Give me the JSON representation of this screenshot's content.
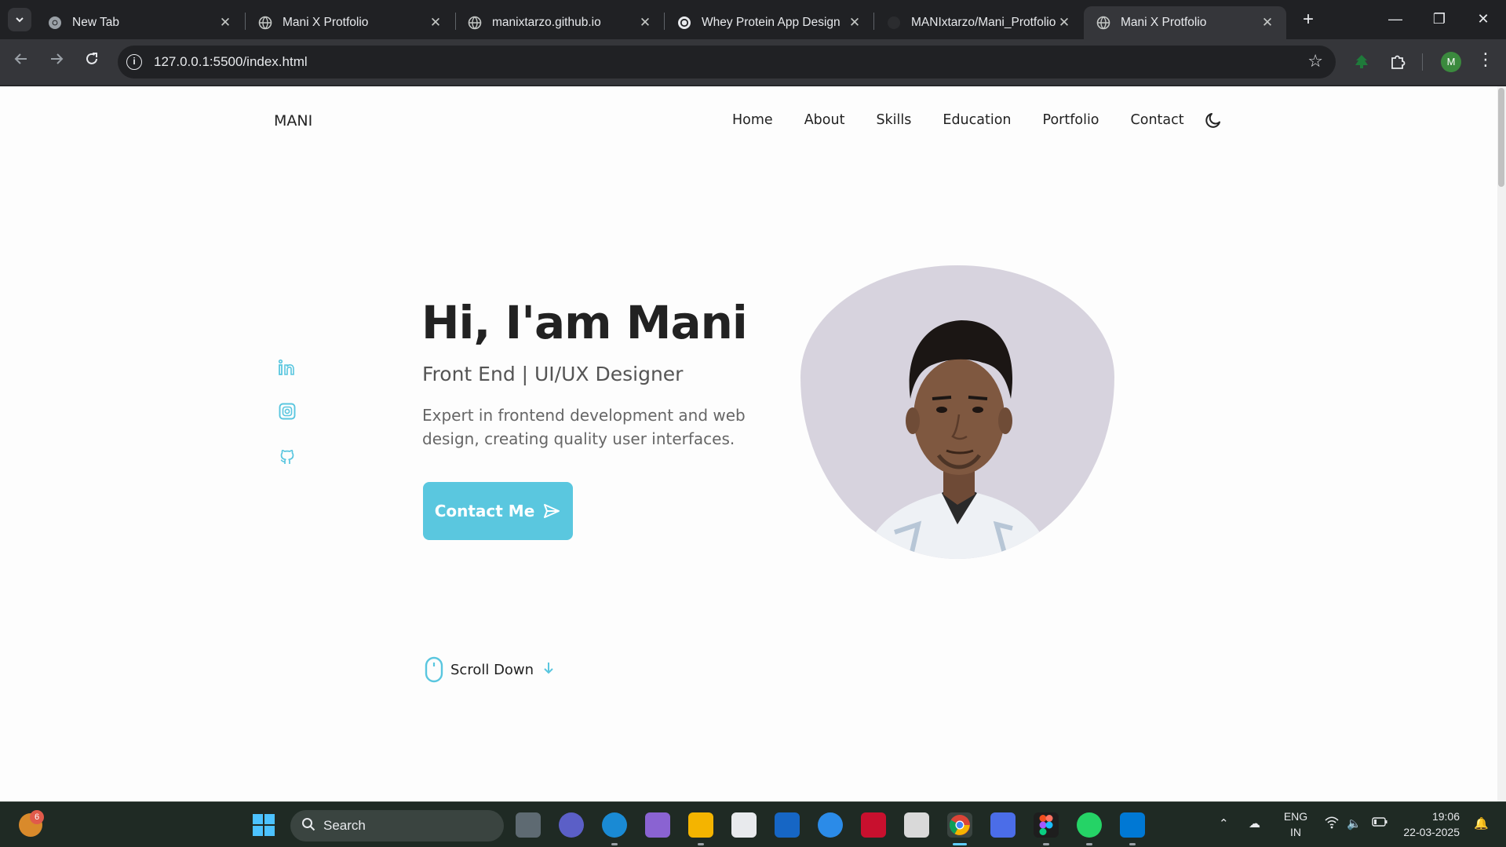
{
  "browser": {
    "tabs": [
      {
        "title": "New Tab",
        "active": false
      },
      {
        "title": "Mani X Protfolio",
        "active": false
      },
      {
        "title": "manixtarzo.github.io",
        "active": false
      },
      {
        "title": "Whey Protein App Design",
        "active": false
      },
      {
        "title": "MANIxtarzo/Mani_Protfolio",
        "active": false
      },
      {
        "title": "Mani X Protfolio",
        "active": true
      }
    ],
    "url": "127.0.0.1:5500/index.html",
    "profile_initial": "M",
    "accent": "#35363a"
  },
  "page": {
    "logo": "MANI",
    "nav": [
      "Home",
      "About",
      "Skills",
      "Education",
      "Portfolio",
      "Contact"
    ],
    "hero": {
      "title": "Hi, I'am Mani",
      "subtitle": "Front End | UI/UX Designer",
      "description": "Expert in frontend development and web design, creating quality user interfaces.",
      "cta_label": "Contact Me"
    },
    "socials": [
      "linkedin-icon",
      "instagram-icon",
      "github-icon"
    ],
    "scroll_label": "Scroll Down",
    "colors": {
      "accent": "#5ac7df",
      "text": "#222222",
      "blob": "#d7d3de"
    }
  },
  "taskbar": {
    "weather_badge": "6",
    "search_placeholder": "Search",
    "language_top": "ENG",
    "language_bottom": "IN",
    "time": "19:06",
    "date": "22-03-2025"
  }
}
